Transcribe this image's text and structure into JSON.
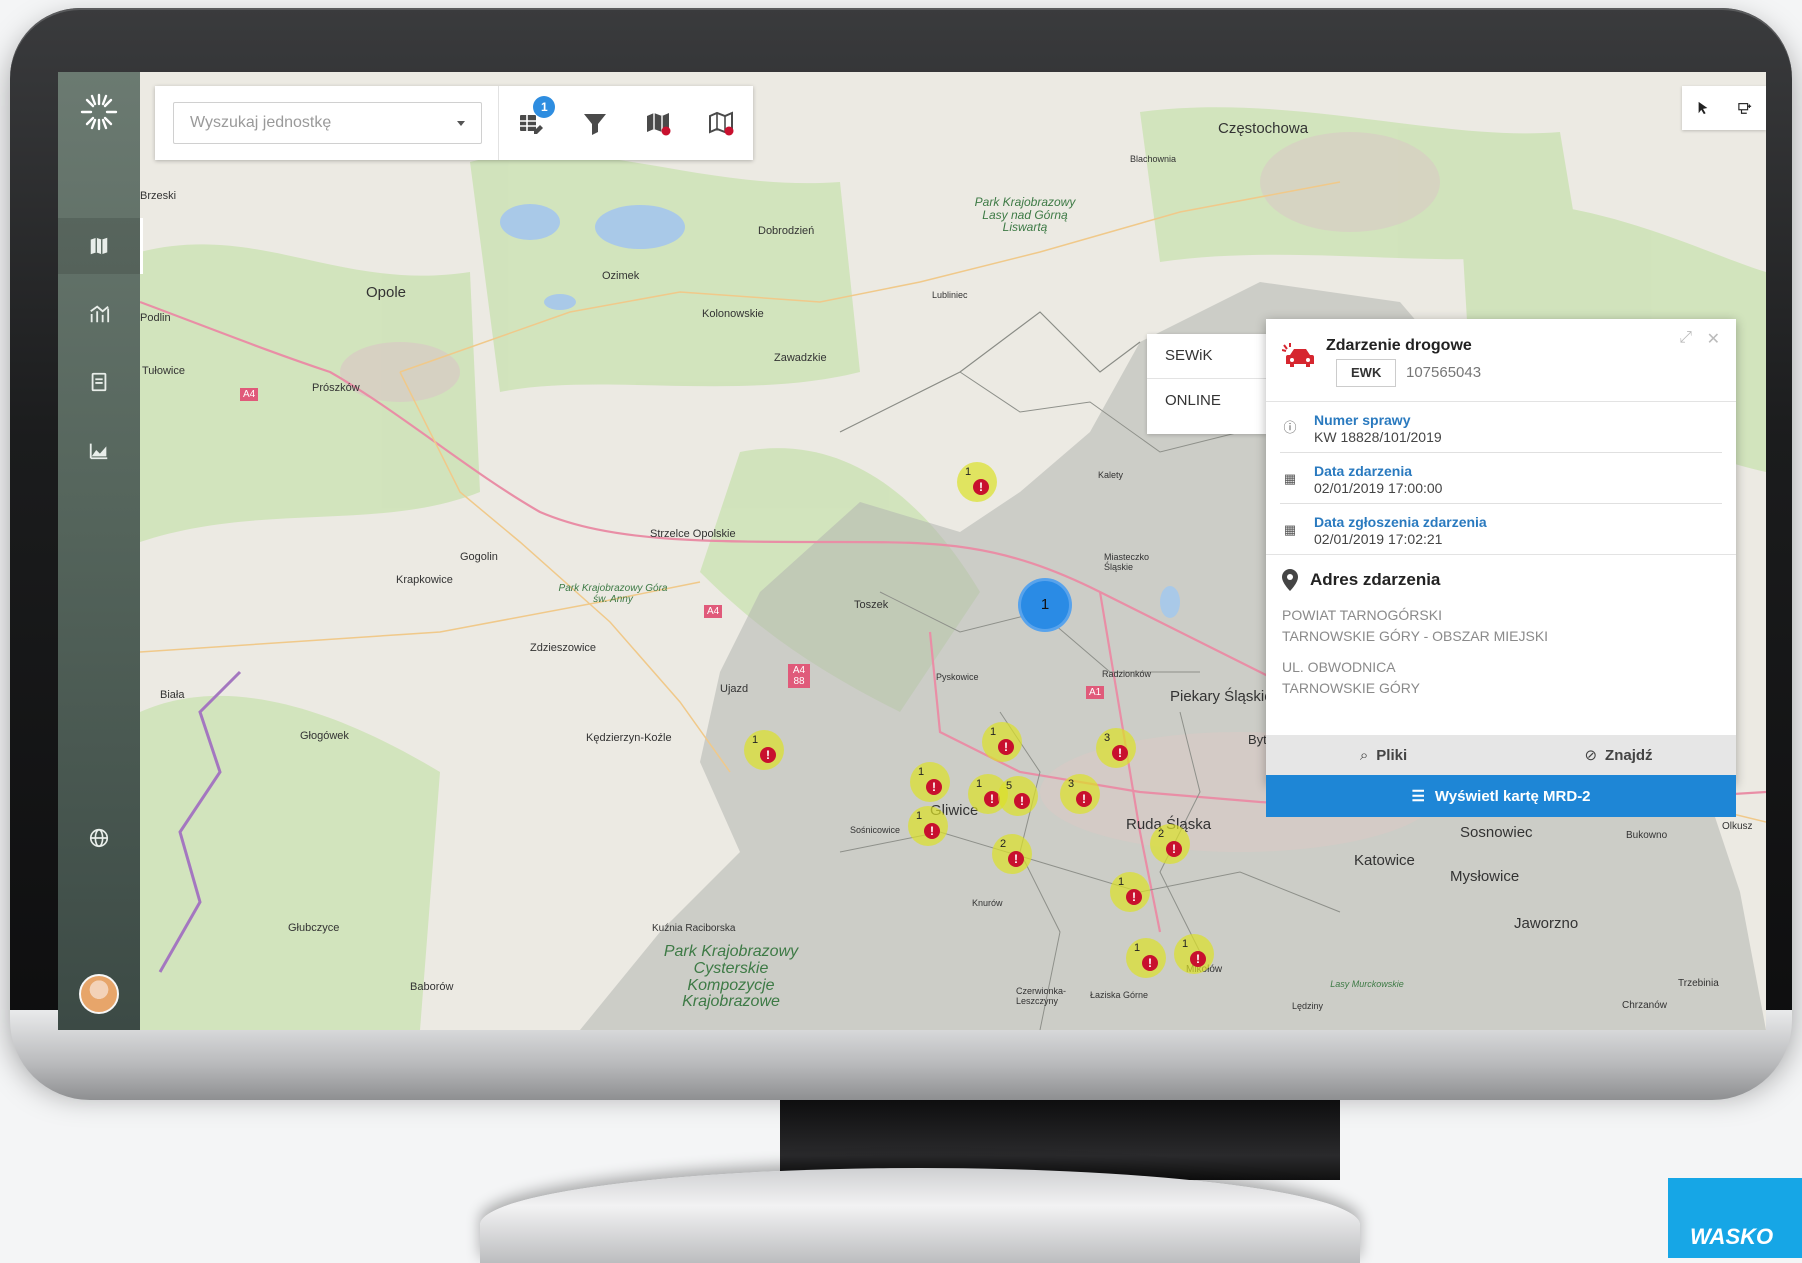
{
  "search": {
    "placeholder": "Wyszukaj jednostkę"
  },
  "toolbar": {
    "badge_count": "1",
    "icons": [
      "table-edit-icon",
      "filter-icon",
      "map-filter-icon",
      "map-alert-icon"
    ]
  },
  "sources": [
    "SEWiK",
    "ONLINE"
  ],
  "popup": {
    "title": "Zdarzenie drogowe",
    "tag": "EWK",
    "id": "107565043",
    "fields": [
      {
        "label": "Numer sprawy",
        "value": "KW 18828/101/2019",
        "icon": "question-icon"
      },
      {
        "label": "Data zdarzenia",
        "value": "02/01/2019 17:00:00",
        "icon": "calendar-icon"
      },
      {
        "label": "Data zgłoszenia zdarzenia",
        "value": "02/01/2019 17:02:21",
        "icon": "calendar-icon"
      }
    ],
    "address_title": "Adres zdarzenia",
    "address_lines": [
      "POWIAT TARNOGÓRSKI",
      "TARNOWSKIE GÓRY - OBSZAR MIEJSKI",
      "UL. OBWODNICA",
      "TARNOWSKIE GÓRY"
    ],
    "files_label": "Pliki",
    "find_label": "Znajdź",
    "cta_label": "Wyświetl kartę MRD-2"
  },
  "map": {
    "cluster_count": "1",
    "places": [
      "Częstochowa",
      "Blachownia",
      "Dobrodzień",
      "Ozimek",
      "Opole",
      "Kolonowskie",
      "Lubliniec",
      "Zawadzkie",
      "Prószków",
      "Tułowice",
      "Strzelce Opolskie",
      "Gogolin",
      "Krapkowice",
      "Zdzieszowice",
      "Toszek",
      "Kalety",
      "Miasteczko Śląskie",
      "Radzionków",
      "Piekary Śląskie",
      "Ujazd",
      "Biała",
      "Głogówek",
      "Kędzierzyn-Koźle",
      "Pyskowice",
      "Gliwice",
      "Ruda Śląska",
      "Sosnowiec",
      "Katowice",
      "Mysłowice",
      "Jaworzno",
      "Sośnicowice",
      "Knurów",
      "Mikołów",
      "Łaziska Górne",
      "Lędziny",
      "Chrzanów",
      "Trzebinia",
      "Bukowno",
      "Olkusz",
      "Głubczyce",
      "Baborów",
      "Kuźnia Raciborska",
      "Czerwionka-Leszczyny",
      "Bytom",
      "Brzeski",
      "Podlin"
    ],
    "parks": [
      "Park Krajobrazowy Lasy nad Górną Liswartą",
      "Park Krajobrazowy Góra św. Anny",
      "Park Krajobrazowy Cysterskie Kompozycje Krajobrazowe",
      "Lasy Murckowskie"
    ],
    "road_labels": [
      "A4",
      "A4",
      "A4 88",
      "A1"
    ],
    "markers": [
      {
        "count": "1"
      },
      {
        "count": "1"
      },
      {
        "count": "1"
      },
      {
        "count": "3"
      },
      {
        "count": "1"
      },
      {
        "count": "1"
      },
      {
        "count": "5"
      },
      {
        "count": "3"
      },
      {
        "count": "1"
      },
      {
        "count": "2"
      },
      {
        "count": "2"
      },
      {
        "count": "1"
      },
      {
        "count": "1"
      },
      {
        "count": "1"
      }
    ]
  },
  "brand": {
    "text": "WASKO"
  },
  "colors": {
    "accent": "#1e86d6",
    "alert": "#c8102e",
    "sidebar": "#55655c",
    "marker": "#dce128"
  }
}
